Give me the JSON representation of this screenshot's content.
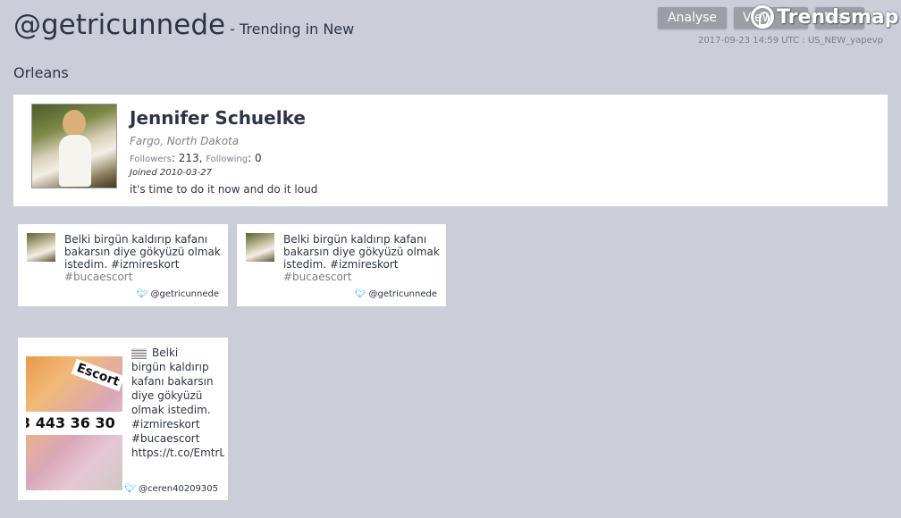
{
  "header": {
    "handle": "@getricunnede",
    "trend_suffix": "- Trending in New",
    "city": "Orleans",
    "buttons": {
      "analyse": "Analyse",
      "view": "View",
      "map": "Map"
    },
    "logo_text": "Trendsmap",
    "stamp": "2017-09-23 14:59 UTC : US_NEW_yapevp"
  },
  "profile": {
    "name": "Jennifer Schuelke",
    "location": "Fargo, North Dakota",
    "followers_label": "Followers",
    "followers": "213",
    "following_label": "Following",
    "following": "0",
    "joined": "Joined 2010-03-27",
    "bio": "it's time to do it now and do it loud"
  },
  "tweets": [
    {
      "text": "Belki birgün kaldırıp kafanı bakarsın diye gökyüzü olmak istedim. #izmireskort",
      "text_fade": "#bucaescort",
      "user": "@getricunnede"
    },
    {
      "text": "Belki birgün kaldırıp kafanı bakarsın diye gökyüzü olmak istedim. #izmireskort",
      "text_fade": "#bucaescort",
      "user": "@getricunnede"
    },
    {
      "text": "Belki\nbirgün kaldırıp\nkafanı bakarsın\ndiye gökyüzü\nolmak istedim.\n#izmireskort\n#bucaescort\nhttps://t.co/EmtrL",
      "photo_band": "3 443 36 30",
      "photo_tag": "Escort",
      "user": "@ceren40209305"
    }
  ],
  "colors": {
    "background": "#cbced8",
    "card": "#ffffff",
    "button": "#9b9ea6",
    "twitter": "#1da1f2"
  }
}
